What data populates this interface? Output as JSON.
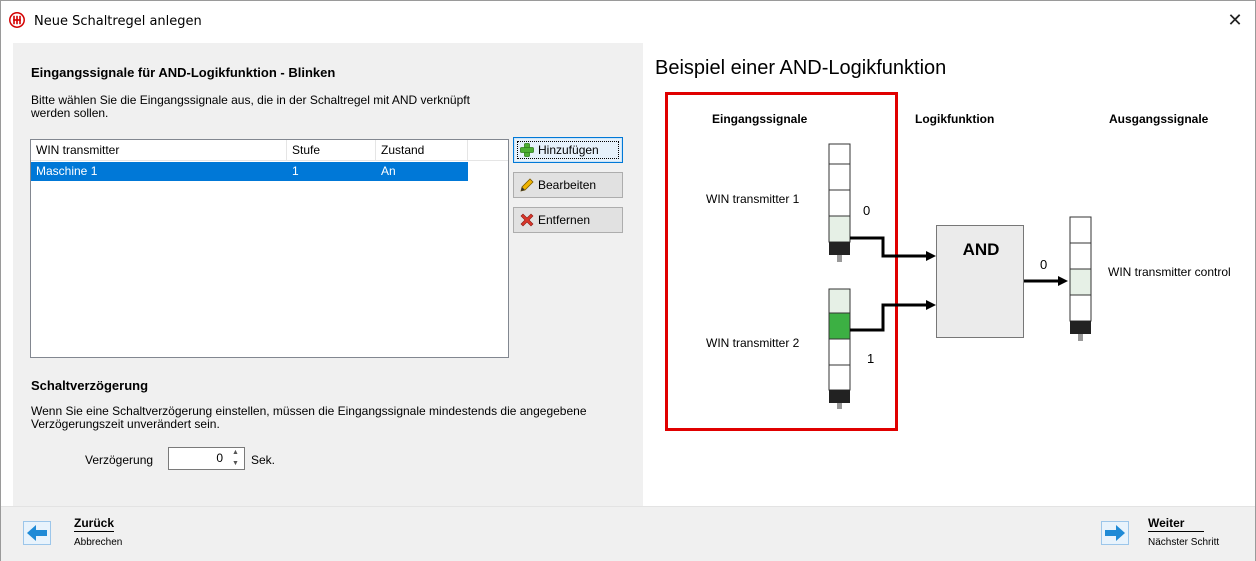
{
  "window": {
    "title": "Neue Schaltregel anlegen",
    "close_symbol": "✕"
  },
  "left": {
    "heading": "Eingangssignale für AND-Logikfunktion - Blinken",
    "description": "Bitte wählen Sie die Eingangssignale aus, die in der Schaltregel mit AND verknüpft werden sollen.",
    "list": {
      "columns": [
        "WIN transmitter",
        "Stufe",
        "Zustand"
      ],
      "rows": [
        {
          "transmitter": "Maschine 1",
          "stufe": "1",
          "zustand": "An",
          "selected": true
        }
      ]
    },
    "buttons": {
      "add": "Hinzufügen",
      "edit": "Bearbeiten",
      "remove": "Entfernen"
    },
    "delay": {
      "heading": "Schaltverzögerung",
      "description": "Wenn Sie eine Schaltverzögerung einstellen, müssen die Eingangssignale mindestends die angegebene Verzögerungszeit unverändert sein.",
      "label": "Verzögerung",
      "value": "0",
      "unit": "Sek."
    }
  },
  "diagram": {
    "title": "Beispiel einer AND-Logikfunktion",
    "headers": {
      "inputs": "Eingangssignale",
      "logic": "Logikfunktion",
      "outputs": "Ausgangssignale"
    },
    "input1": {
      "label": "WIN transmitter 1",
      "value": "0"
    },
    "input2": {
      "label": "WIN transmitter 2",
      "value": "1"
    },
    "function": "AND",
    "output": {
      "label": "WIN transmitter control",
      "value": "0"
    },
    "colors": {
      "highlight": "#e00000",
      "lamp_on": "#3cb043",
      "lamp_dim": "#e6f0e6"
    }
  },
  "footer": {
    "back_title": "Zurück",
    "back_sub": "Abbrechen",
    "next_title": "Weiter",
    "next_sub": "Nächster Schritt"
  }
}
